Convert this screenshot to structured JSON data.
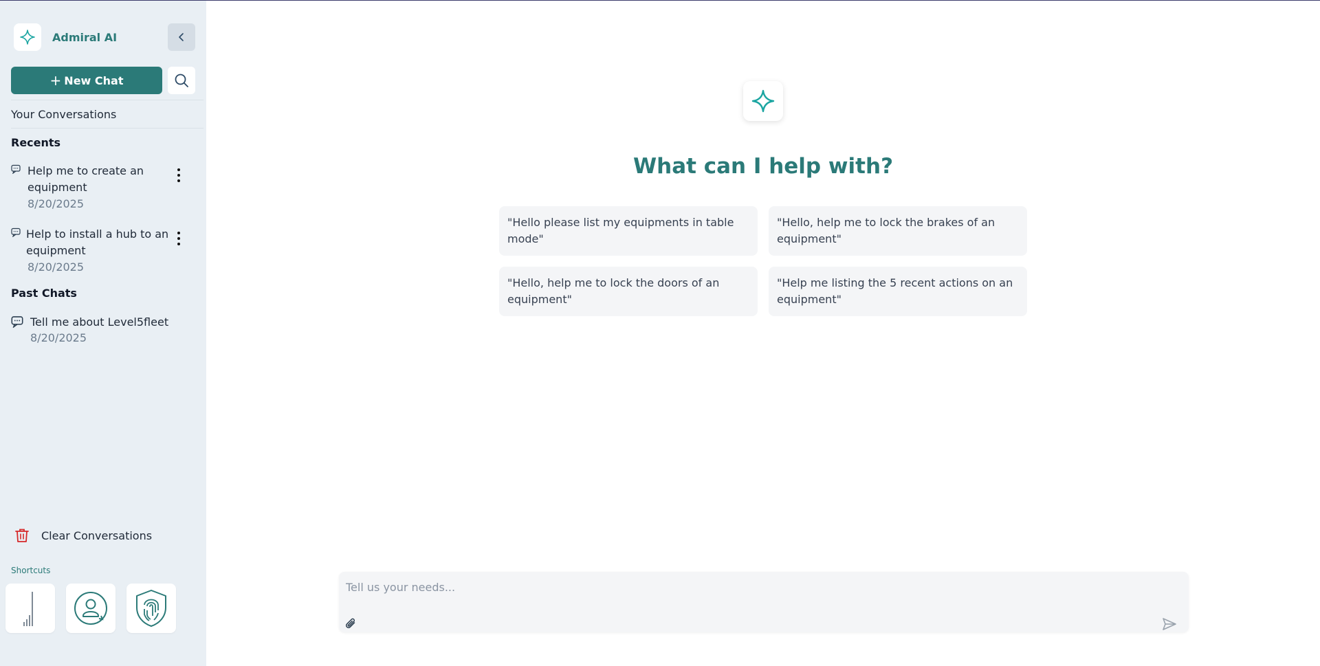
{
  "app": {
    "name": "Admiral AI"
  },
  "sidebar": {
    "new_chat_label": "New Chat",
    "your_conversations": "Your Conversations",
    "recents_title": "Recents",
    "recents": [
      {
        "title": "Help me to create an equipment",
        "date": "8/20/2025"
      },
      {
        "title": "Help to install a hub to an equipment",
        "date": "8/20/2025"
      }
    ],
    "past_title": "Past Chats",
    "past": [
      {
        "title": "Tell me about Level5fleet",
        "date": "8/20/2025"
      }
    ],
    "clear_label": "Clear Conversations",
    "shortcuts_label": "Shortcuts",
    "shortcuts": [
      {
        "icon": "bar-chart-icon"
      },
      {
        "icon": "user-sync-icon"
      },
      {
        "icon": "fingerprint-shield-icon"
      }
    ]
  },
  "main": {
    "headline": "What can I help with?",
    "suggestions": [
      "\"Hello please list my equipments in table mode\"",
      "\"Hello, help me to lock the brakes of an equipment\"",
      "\"Hello, help me to lock the doors of an equipment\"",
      "\"Help me listing the 5 recent actions on an equipment\""
    ],
    "composer": {
      "placeholder": "Tell us your needs..."
    }
  },
  "colors": {
    "accent": "#2b7a78",
    "sparkle": "#1aa5a1",
    "sidebar_bg": "#e9eff4",
    "danger": "#d62828"
  }
}
